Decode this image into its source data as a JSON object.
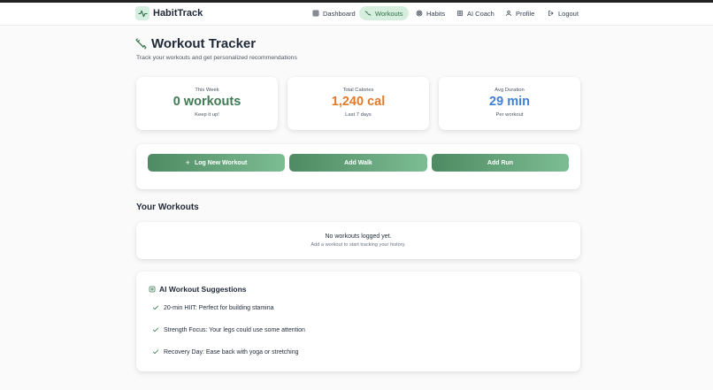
{
  "brand": {
    "name": "HabitTrack",
    "accent": "#4e8a63"
  },
  "nav": {
    "items": [
      {
        "label": "Dashboard",
        "icon": "dashboard-grid-icon",
        "active": false
      },
      {
        "label": "Workouts",
        "icon": "activity-pulse-icon",
        "active": true
      },
      {
        "label": "Habits",
        "icon": "target-icon",
        "active": false
      },
      {
        "label": "AI Coach",
        "icon": "ai-chip-icon",
        "active": false
      },
      {
        "label": "Profile",
        "icon": "user-icon",
        "active": false
      },
      {
        "label": "Logout",
        "icon": "logout-icon",
        "active": false
      }
    ]
  },
  "page": {
    "title": "Workout Tracker",
    "subtitle": "Track your workouts and get personalized recommendations"
  },
  "stats": [
    {
      "label": "This Week",
      "value": "0 workouts",
      "hint": "Keep it up!",
      "color": "#3f7a55"
    },
    {
      "label": "Total Calories",
      "value": "1,240 cal",
      "hint": "Last 7 days",
      "color": "#e07a2f"
    },
    {
      "label": "Avg Duration",
      "value": "29 min",
      "hint": "Per workout",
      "color": "#3f7fd6"
    }
  ],
  "actions": {
    "log_label": "Log New Workout",
    "walk_label": "Add Walk",
    "run_label": "Add Run"
  },
  "workouts": {
    "title": "Your Workouts",
    "empty_title": "No workouts logged yet.",
    "empty_hint": "Add a workout to start tracking your history."
  },
  "ai": {
    "title": "AI Workout Suggestions",
    "suggestions": [
      "20-min HIIT: Perfect for building stamina",
      "Strength Focus: Your legs could use some attention",
      "Recovery Day: Ease back with yoga or stretching"
    ]
  }
}
